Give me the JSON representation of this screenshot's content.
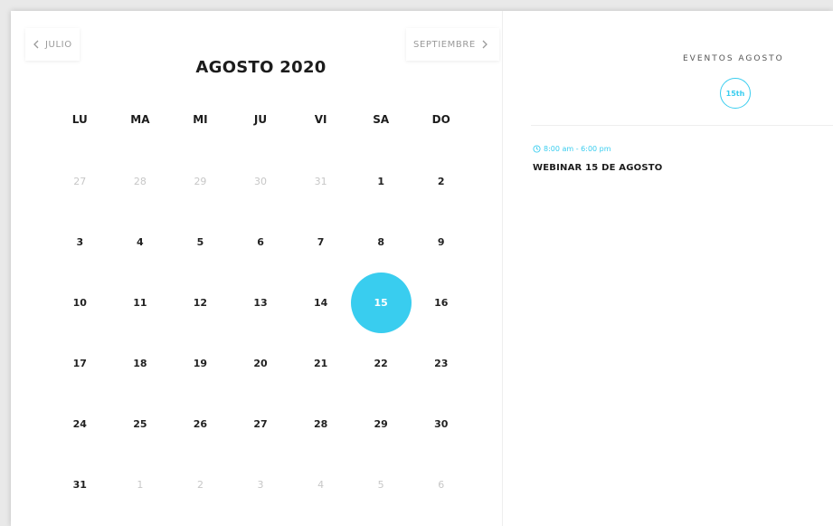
{
  "calendar": {
    "prev_month_label": "JULIO",
    "next_month_label": "SEPTIEMBRE",
    "month_title": "AGOSTO 2020",
    "weekdays": [
      "LU",
      "MA",
      "MI",
      "JU",
      "VI",
      "SA",
      "DO"
    ],
    "weeks": [
      [
        "27",
        "28",
        "29",
        "30",
        "31",
        "1",
        "2"
      ],
      [
        "3",
        "4",
        "5",
        "6",
        "7",
        "8",
        "9"
      ],
      [
        "10",
        "11",
        "12",
        "13",
        "14",
        "15",
        "16"
      ],
      [
        "17",
        "18",
        "19",
        "20",
        "21",
        "22",
        "23"
      ],
      [
        "24",
        "25",
        "26",
        "27",
        "28",
        "29",
        "30"
      ],
      [
        "31",
        "1",
        "2",
        "3",
        "4",
        "5",
        "6"
      ]
    ],
    "selected_day": "15"
  },
  "events_panel": {
    "heading": "EVENTOS AGOSTO",
    "day_badge": "15th",
    "events": [
      {
        "time": "8:00 am - 6:00 pm",
        "title": "WEBINAR 15 DE AGOSTO"
      }
    ]
  },
  "colors": {
    "accent": "#39cdef",
    "muted_text": "#c7c7c7",
    "text": "#1c1c1c"
  },
  "icons": {
    "prev": "chevron-left-icon",
    "next": "chevron-right-icon",
    "clock": "clock-icon"
  }
}
